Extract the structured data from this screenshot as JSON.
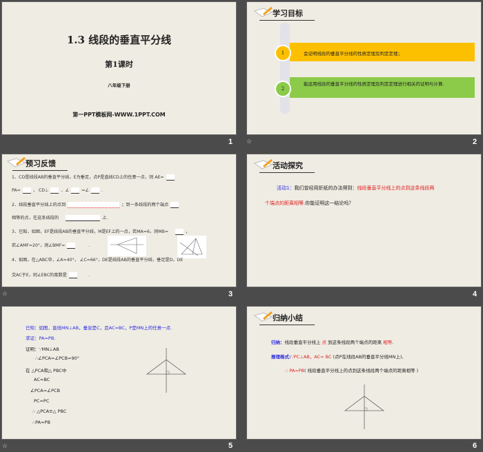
{
  "slides": [
    {
      "number": "1",
      "title": "1.3  线段的垂直平分线",
      "subtitle": "第1课时",
      "grade": "八年级下册",
      "site": "第一PPT模板网-WWW.1PPT.COM"
    },
    {
      "number": "2",
      "header": "学习目标",
      "goals": [
        {
          "index": "1",
          "text": "会证明线段的垂直平分线的性质定理及判定定理；",
          "color": "#fdc000"
        },
        {
          "index": "2",
          "text": "能运用线段的垂直平分线的性质定理及判定定理进行相关的证明与计算.",
          "color": "#8ccb4a"
        }
      ]
    },
    {
      "number": "3",
      "header": "预习反馈",
      "lines": [
        "1．CD是线段AB的垂直平分线，E为垂足，点P是直线CD上的任意一点，则    AE=",
        "PA=",
        "，  CD⊥",
        "．∠",
        "=∠",
        ".",
        "2．线段垂直平分线上的点到",
        "；到一条线段的两个端点",
        "相等的点，在这条线段的",
        "上.",
        "3．已知，如图，EF是线段AB的垂直平分线，M是EF上的一点，若MA=6，则MB=",
        "，",
        "若∠AMF=20°，则∠BMF=",
        ".",
        "4．如图，在△ABC中，∠A=40°，  ∠C=66°，DE是线段AB的垂直平分线，垂足是D，DE",
        "交AC于E，则∠EBC的度数是",
        "."
      ]
    },
    {
      "number": "4",
      "header": "活动探究",
      "label": "活动1：",
      "text": "我们曾经用折纸的办法得到：",
      "highlight1": "线段垂直平分线上的点到这条线段两",
      "highlight2": "个端点的距离相等",
      "tail": ".你能证明这一结论吗？"
    },
    {
      "number": "5",
      "given": "已知：如图，直线MN⊥AB，垂足是C，且AC=BC，P是MN上的任意一点.",
      "prove": "求证：PA=PB.",
      "proof": [
        "证明：∵MN⊥AB",
        "∴∠PCA=∠PCB=90°",
        "在 △PCA和△ PBC中",
        "AC=BC",
        "∠PCA=∠PCB",
        "PC=PC",
        "∴ △PCA≌△ PBC",
        "∴PA=PB"
      ]
    },
    {
      "number": "6",
      "header": "归纳小结",
      "sum_label": "归纳：",
      "sum_a": "线段垂直平分线上",
      "sum_b": "点",
      "sum_c": "到这条线段两个端点的距离",
      "sum_d": "相等",
      "sum_e": ".",
      "fmt_label": "推理格式:",
      "fmt_a": "∵PC⊥AB，AC= BC",
      "fmt_b": "(点P在线段AB的垂直平分线MN上),",
      "con_a": "∴ PA=PB",
      "con_b": "( 线段垂直平分线上的点到这条线段两个端点的距离相等 )"
    }
  ],
  "footer_icon": "star-icon",
  "colors": {
    "background": "#4b4b4b",
    "slide": "#efece3",
    "blue": "#2a2ae0",
    "red": "#e02020"
  }
}
